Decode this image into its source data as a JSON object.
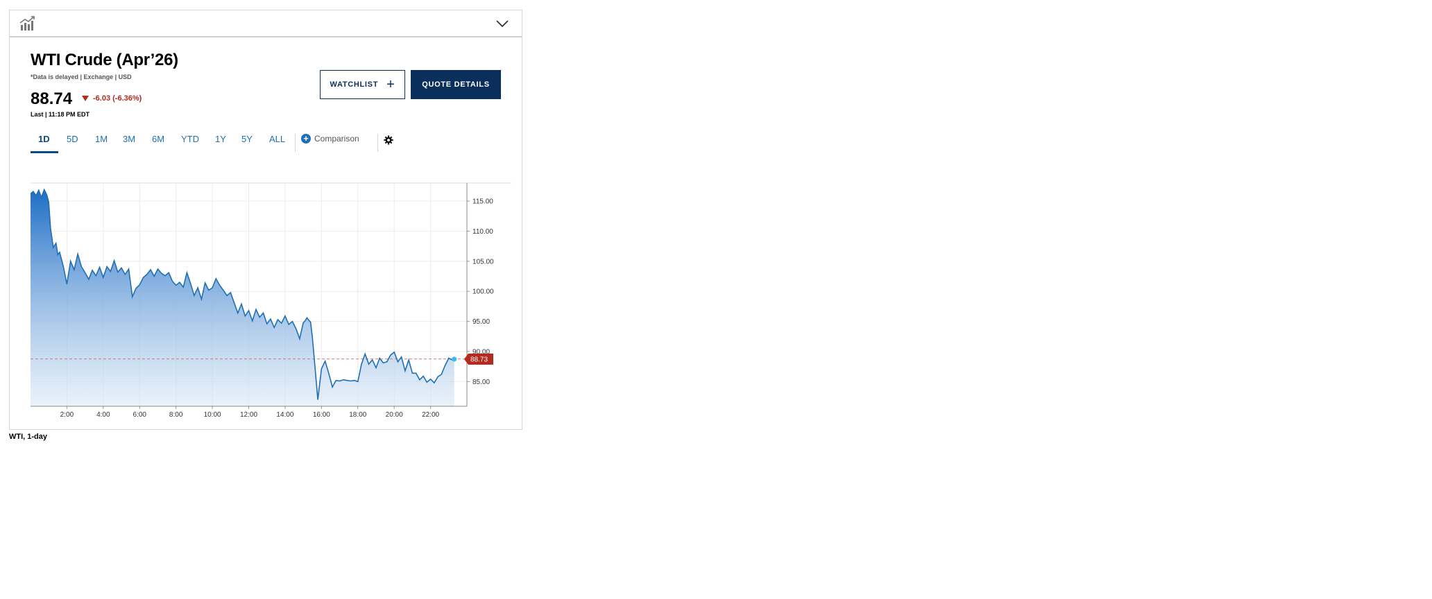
{
  "header": {
    "title": "WTI Crude (Apr’26)",
    "disclaimer": "*Data is delayed | Exchange | USD",
    "price": "88.74",
    "change": "-6.03 (-6.36%)",
    "last_updated": "Last | 11:18 PM EDT"
  },
  "buttons": {
    "watchlist": "WATCHLIST",
    "quote_details": "QUOTE DETAILS"
  },
  "tabs": [
    "1D",
    "5D",
    "1M",
    "3M",
    "6M",
    "YTD",
    "1Y",
    "5Y",
    "ALL"
  ],
  "active_tab": "1D",
  "comparison_label": "Comparison",
  "caption": "WTI, 1-day",
  "colors": {
    "navy": "#0b2f5d",
    "line": "#1e6fb3",
    "negative": "#b22b1e"
  },
  "chart_data": {
    "type": "area",
    "x_ticks": [
      "2:00",
      "4:00",
      "6:00",
      "8:00",
      "10:00",
      "12:00",
      "14:00",
      "16:00",
      "18:00",
      "20:00",
      "22:00"
    ],
    "y_ticks": [
      "115.00",
      "110.00",
      "105.00",
      "100.00",
      "95.00",
      "90.00",
      "85.00"
    ],
    "ylim": [
      80.9,
      118.0
    ],
    "xlim": [
      0,
      24
    ],
    "last_price_label": "88.73",
    "reference_price": 88.77,
    "grid": true,
    "x_hours": [
      0,
      0.15,
      0.3,
      0.45,
      0.6,
      0.75,
      0.9,
      1.0,
      1.1,
      1.25,
      1.4,
      1.5,
      1.6,
      1.8,
      2.0,
      2.2,
      2.4,
      2.6,
      2.8,
      3.0,
      3.2,
      3.4,
      3.6,
      3.8,
      4.0,
      4.2,
      4.4,
      4.6,
      4.8,
      5.0,
      5.2,
      5.4,
      5.6,
      5.8,
      6.0,
      6.2,
      6.4,
      6.6,
      6.8,
      7.0,
      7.2,
      7.4,
      7.6,
      7.8,
      8.0,
      8.2,
      8.4,
      8.6,
      8.8,
      9.0,
      9.2,
      9.4,
      9.6,
      9.8,
      10.0,
      10.2,
      10.4,
      10.6,
      10.8,
      11.0,
      11.2,
      11.4,
      11.6,
      11.8,
      12.0,
      12.2,
      12.4,
      12.6,
      12.8,
      13.0,
      13.2,
      13.4,
      13.6,
      13.8,
      14.0,
      14.2,
      14.4,
      14.6,
      14.8,
      15.0,
      15.1,
      15.2,
      15.3,
      15.4,
      15.5,
      15.6,
      15.8,
      16.0,
      16.2,
      16.4,
      16.6,
      16.8,
      17.0,
      17.2,
      17.4,
      17.6,
      17.8,
      18.0,
      18.2,
      18.4,
      18.6,
      18.8,
      19.0,
      19.2,
      19.4,
      19.6,
      19.8,
      20.0,
      20.2,
      20.4,
      20.6,
      20.8,
      21.0,
      21.2,
      21.4,
      21.6,
      21.8,
      22.0,
      22.2,
      22.4,
      22.6,
      22.8,
      23.0,
      23.2,
      23.3
    ],
    "y_values": [
      116.2,
      116.6,
      115.9,
      116.8,
      115.6,
      116.9,
      116.0,
      114.8,
      110.5,
      107.3,
      108.0,
      106.1,
      106.5,
      104.2,
      101.2,
      105.0,
      103.6,
      106.2,
      104.1,
      103.1,
      102.0,
      103.5,
      102.6,
      104.0,
      102.3,
      104.1,
      103.3,
      105.1,
      103.2,
      103.9,
      102.8,
      103.7,
      99.1,
      100.5,
      101.1,
      102.3,
      102.8,
      103.6,
      102.5,
      103.7,
      103.0,
      102.6,
      103.1,
      101.7,
      101.0,
      101.5,
      100.7,
      103.1,
      101.3,
      99.3,
      100.6,
      98.7,
      101.4,
      100.2,
      100.6,
      102.1,
      101.0,
      100.2,
      99.3,
      99.8,
      98.1,
      96.4,
      97.9,
      95.9,
      96.8,
      95.1,
      97.0,
      95.7,
      96.4,
      94.6,
      95.4,
      94.0,
      95.3,
      94.7,
      95.9,
      94.5,
      95.0,
      93.8,
      92.1,
      94.8,
      95.1,
      95.6,
      95.2,
      94.9,
      92.4,
      88.9,
      82.0,
      87.1,
      88.4,
      86.4,
      84.1,
      85.2,
      85.1,
      85.3,
      85.2,
      85.1,
      85.2,
      85.0,
      87.9,
      89.6,
      87.9,
      88.6,
      87.3,
      88.9,
      88.1,
      88.3,
      89.4,
      89.9,
      88.3,
      89.1,
      86.8,
      88.6,
      86.4,
      86.4,
      85.3,
      85.9,
      84.9,
      85.4,
      84.8,
      85.8,
      86.2,
      87.7,
      88.9,
      88.6,
      88.73
    ]
  }
}
